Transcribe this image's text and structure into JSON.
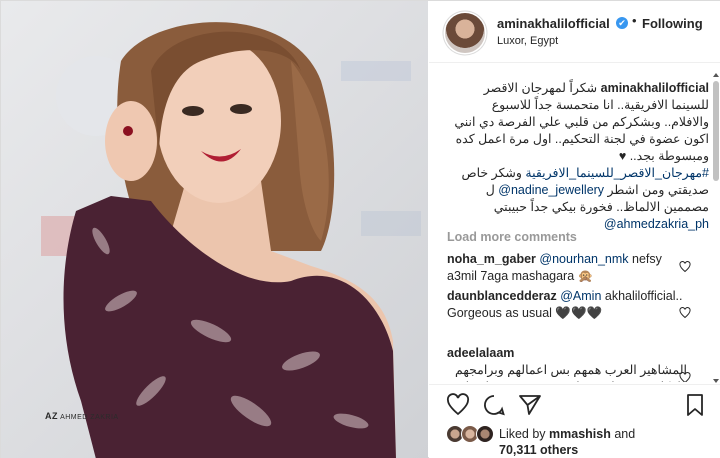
{
  "header": {
    "username": "aminakhalilofficial",
    "verified_icon": "✔",
    "separator": "•",
    "follow_status": "Following",
    "location": "Luxor, Egypt"
  },
  "photo": {
    "watermark_prefix": "AZ",
    "watermark_name": "AHMED ZAKRIA"
  },
  "caption": {
    "username": "aminakhalilofficial",
    "text_1": "شكراً لمهرجان الاقصر للسينما الافريقية.. انا متحمسة جداً للاسبوع والافلام.. وبشكركم من قلبي علي الفرصة دي انني اكون عضوة في لجنة التحكيم.. اول مرة اعمل كده ومبسوطة بجد.. ♥",
    "hashtag": "#مهرجان_الاقصر_للسينما_الافريقية",
    "text_2": " وشكر خاص صديقتي ومن اشطر ",
    "mention_1": "@nadine_jewellery",
    "text_3": " ل مصممين الالماظ.. فخورة بيكي جداً حبيبتي ",
    "mention_2": "@ahmedzakria_ph"
  },
  "load_more": "Load more comments",
  "comments": [
    {
      "user": "noha_m_gaber",
      "mention": "@nourhan_nmk",
      "text": " nefsy a3mil 7aga mashagara 🙊"
    },
    {
      "user": "daunblancedderaz",
      "mention": "@Amin",
      "text": "akhalilofficial.. Gorgeous as usual 🖤🖤🖤"
    },
    {
      "user": "adeelalaam",
      "text": "المشاهير العرب همهم بس اعمالهم وبرامجهم ولا كانو خمسطن مسلم هدي دمهم فقط صلا الجمعه بدم حتى"
    }
  ],
  "likes": {
    "liked_by_prefix": "Liked by ",
    "liked_by_user": "mmashish",
    "liked_by_suffix": " and",
    "count_text": "70,311 others"
  },
  "colors": {
    "link": "#003569",
    "verified": "#3897f0",
    "dress": "#4a2233"
  }
}
